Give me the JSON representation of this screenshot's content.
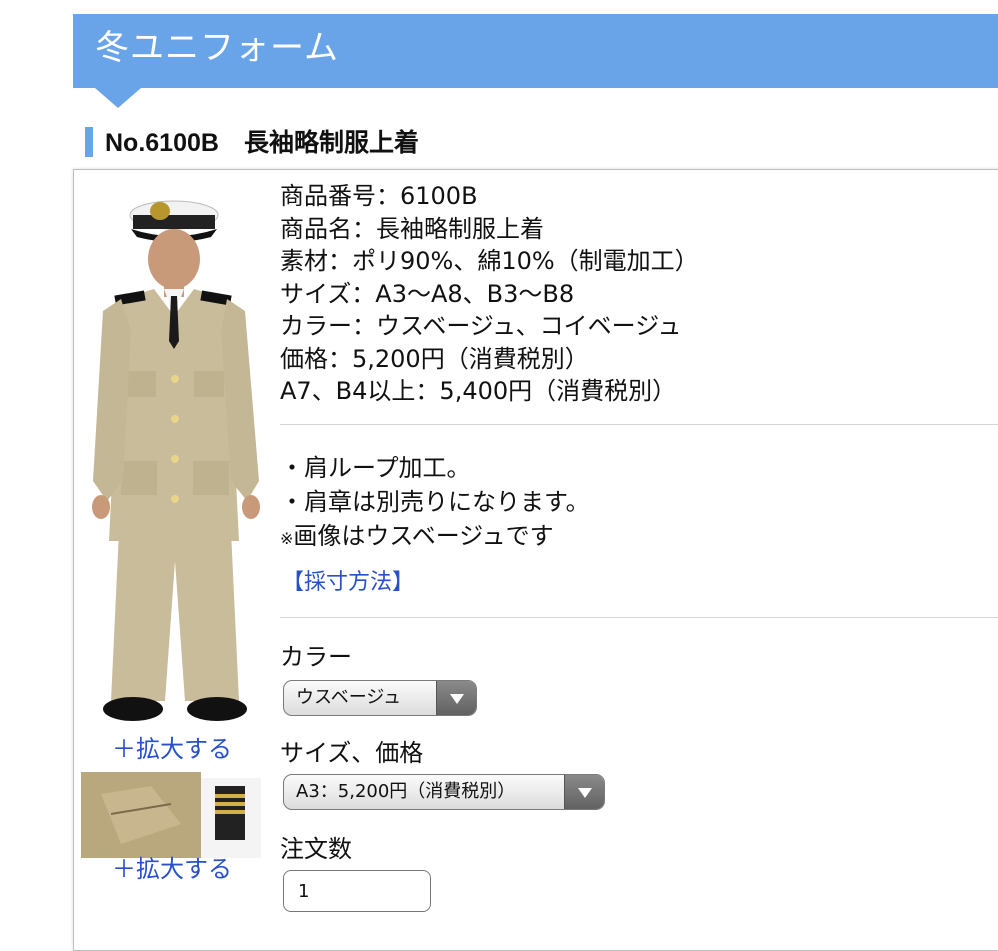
{
  "banner": {
    "title": "冬ユニフォーム"
  },
  "product": {
    "heading": "No.6100B　長袖略制服上着",
    "details": [
      "商品番号：6100B",
      "商品名：長袖略制服上着",
      "素材：ポリ90%、綿10%（制電加工）",
      "サイズ：A3〜A8、B3〜B8",
      "カラー：ウスベージュ、コイベージュ",
      "価格：5,200円（消費税別）",
      "A7、B4以上：5,400円（消費税別）"
    ],
    "notes": [
      "・肩ループ加工。",
      "・肩章は別売りになります。"
    ],
    "note_mark": "※",
    "note_last": "画像はウスベージュです",
    "measure_link": "【採寸方法】",
    "zoom_label_1": "＋拡大する",
    "zoom_label_2": "＋拡大する"
  },
  "form": {
    "color_label": "カラー",
    "color_selected": "ウスベージュ",
    "size_label": "サイズ、価格",
    "size_selected": "A3：5,200円（消費税別）",
    "qty_label": "注文数",
    "qty_value": "1"
  },
  "colors": {
    "accent": "#6aa4e8",
    "link": "#2850c8"
  },
  "icons": {
    "select_arrow": "triangle-down-icon"
  }
}
